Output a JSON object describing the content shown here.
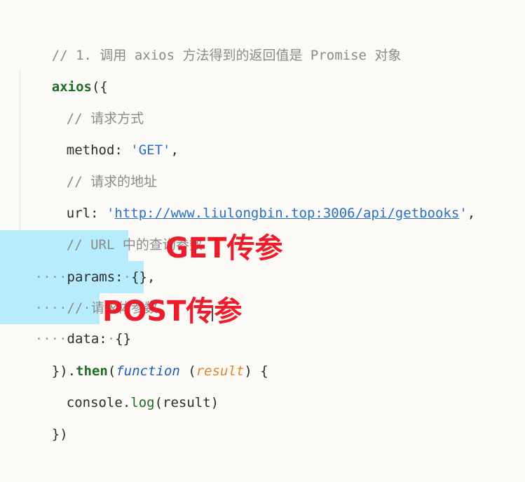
{
  "code": {
    "line1_comment": "// 1. 调用 axios 方法得到的返回值是 Promise 对象",
    "line2_fn": "axios",
    "line2_rest": "({",
    "line3_comment": "// 请求方式",
    "line4_key": "method: ",
    "line4_value": "'GET'",
    "line4_end": ",",
    "line5_comment": "// 请求的地址",
    "line6_key": "url: ",
    "line6_quote_open": "'",
    "line6_url": "http://www.liulongbin.top:3006/api/getbooks",
    "line6_quote_close": "'",
    "line6_end": ",",
    "line7_comment": "// URL 中的查询参数",
    "line8_ws": "····",
    "line8_key": "params:",
    "line8_ws2": "·",
    "line8_value": "{},",
    "line9_ws": "····",
    "line9_comment_a": "//",
    "line9_ws2": "·",
    "line9_comment_b": "请求体参数",
    "line10_ws": "····",
    "line10_key": "data:",
    "line10_ws2": "·",
    "line10_value": "{}",
    "line11_start": "}).",
    "line11_then": "then",
    "line11_paren": "(",
    "line11_function": "function",
    "line11_space": " (",
    "line11_param": "result",
    "line11_end": ") {",
    "line12_obj": "console.",
    "line12_log": "log",
    "line12_args": "(result)",
    "line13": "})"
  },
  "annotations": {
    "get": "GET传参",
    "post": "POST传参"
  },
  "colors": {
    "background": "#fbfaf6",
    "comment": "#8a8a8a",
    "string": "#2a6fc4",
    "function_name": "#1f6b2a",
    "keyword": "#1b5fb8",
    "param": "#d9892e",
    "selection": "#b6ecfb",
    "annotation": "#ec1c2b"
  }
}
